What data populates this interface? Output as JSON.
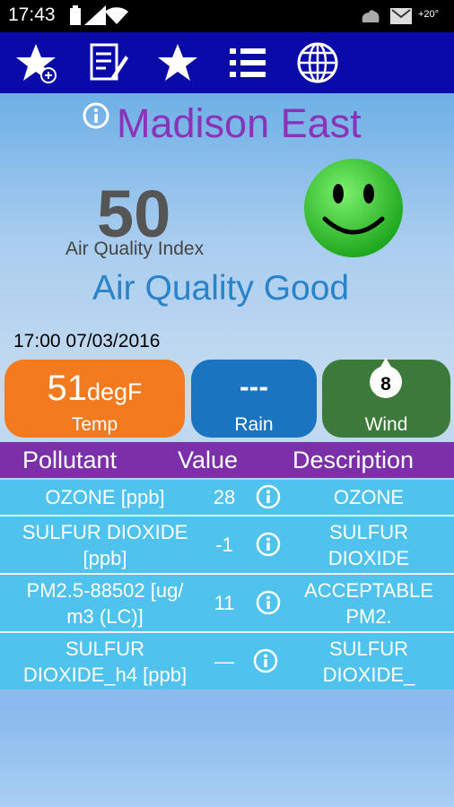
{
  "status_bar": {
    "time": "17:43",
    "temperature": "+20°"
  },
  "toolbar": {
    "icons": [
      "favorite-add-icon",
      "edit-note-icon",
      "favorites-icon",
      "list-icon",
      "globe-icon"
    ]
  },
  "station": {
    "name": "Madison East"
  },
  "aqi": {
    "value": "50",
    "label": "Air Quality Index",
    "status": "Air Quality Good",
    "face_color": "#33cc33"
  },
  "timestamp": "17:00 07/03/2016",
  "weather": {
    "temp": {
      "value": "51",
      "unit": "degF",
      "label": "Temp",
      "color": "#f47a20"
    },
    "rain": {
      "value": "---",
      "label": "Rain",
      "color": "#1a74c0"
    },
    "wind": {
      "value": "8",
      "label": "Wind",
      "color": "#3c7a3c"
    }
  },
  "table": {
    "headers": [
      "Pollutant",
      "Value",
      "Description"
    ],
    "rows": [
      {
        "pollutant": [
          "OZONE [ppb]"
        ],
        "value": "28",
        "description": [
          "OZONE"
        ]
      },
      {
        "pollutant": [
          "SULFUR DIOXIDE",
          "[ppb]"
        ],
        "value": "-1",
        "description": [
          "SULFUR",
          "DIOXIDE"
        ]
      },
      {
        "pollutant": [
          "PM2.5-88502 [ug/",
          "m3 (LC)]"
        ],
        "value": "11",
        "description": [
          "ACCEPTABLE",
          "PM2."
        ]
      },
      {
        "pollutant": [
          "SULFUR",
          "DIOXIDE_h4 [ppb]"
        ],
        "value": "—",
        "description": [
          "SULFUR",
          "DIOXIDE_"
        ]
      }
    ]
  }
}
